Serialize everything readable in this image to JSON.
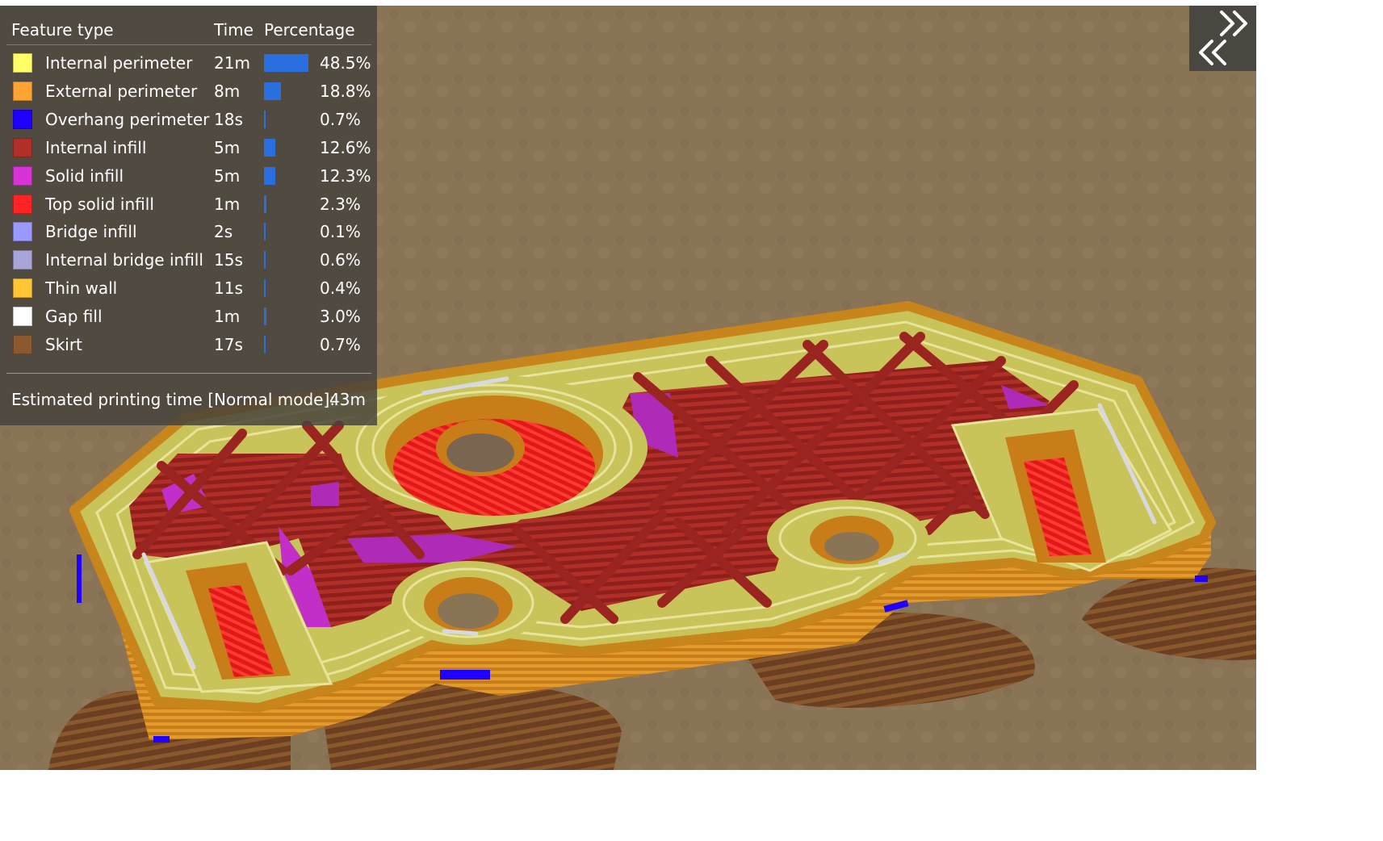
{
  "legend": {
    "header": {
      "feature_type": "Feature type",
      "time": "Time",
      "percentage": "Percentage"
    },
    "rows": [
      {
        "label": "Internal perimeter",
        "time": "21m",
        "percentage": "48.5%",
        "percent_value": 48.5,
        "color": "#ffff68"
      },
      {
        "label": "External perimeter",
        "time": "8m",
        "percentage": "18.8%",
        "percent_value": 18.8,
        "color": "#ffa333"
      },
      {
        "label": "Overhang perimeter",
        "time": "18s",
        "percentage": "0.7%",
        "percent_value": 0.7,
        "color": "#1f00ff"
      },
      {
        "label": "Internal infill",
        "time": "5m",
        "percentage": "12.6%",
        "percent_value": 12.6,
        "color": "#b03029"
      },
      {
        "label": "Solid infill",
        "time": "5m",
        "percentage": "12.3%",
        "percent_value": 12.3,
        "color": "#d733d7"
      },
      {
        "label": "Top solid infill",
        "time": "1m",
        "percentage": "2.3%",
        "percent_value": 2.3,
        "color": "#ff2424"
      },
      {
        "label": "Bridge infill",
        "time": "2s",
        "percentage": "0.1%",
        "percent_value": 0.1,
        "color": "#9999ff"
      },
      {
        "label": "Internal bridge infill",
        "time": "15s",
        "percentage": "0.6%",
        "percent_value": 0.6,
        "color": "#aaa5d8"
      },
      {
        "label": "Thin wall",
        "time": "11s",
        "percentage": "0.4%",
        "percent_value": 0.4,
        "color": "#ffc633"
      },
      {
        "label": "Gap fill",
        "time": "1m",
        "percentage": "3.0%",
        "percent_value": 3.0,
        "color": "#ffffff"
      },
      {
        "label": "Skirt",
        "time": "17s",
        "percentage": "0.7%",
        "percent_value": 0.7,
        "color": "#8a5a2e"
      }
    ],
    "estimated_label": "Estimated printing time [Normal mode]:",
    "estimated_value": "43m"
  },
  "colors": {
    "background": "#8a7456",
    "bar": "#2a6fe0",
    "legend_bg": "#46423c"
  },
  "collapse_button": {
    "icon": "double-chevron-collapse-icon"
  }
}
